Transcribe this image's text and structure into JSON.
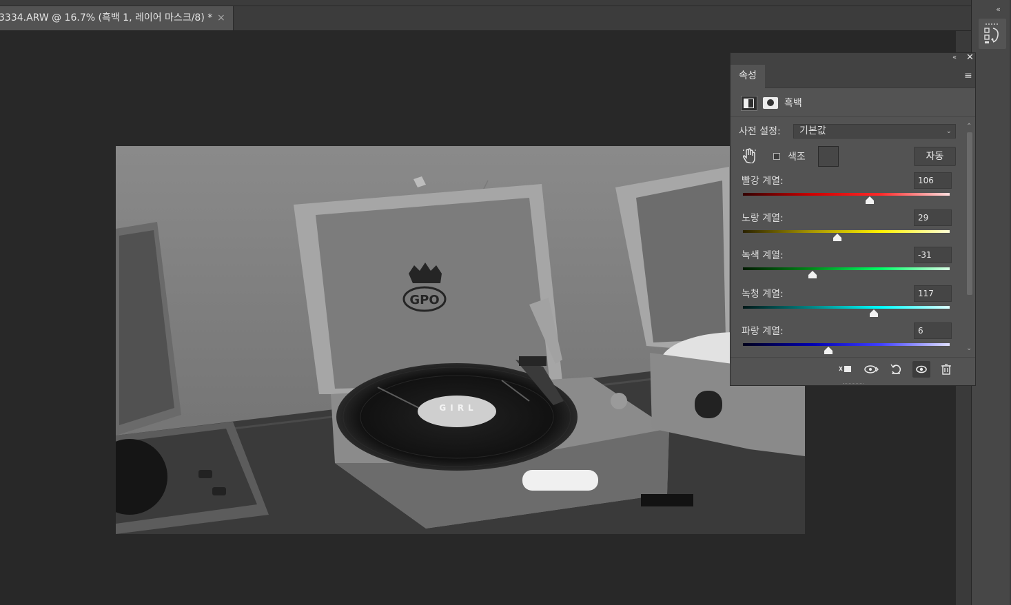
{
  "document_tab": {
    "title": "3334.ARW @ 16.7% (흑백 1, 레이어 마스크/8) *",
    "close_glyph": "×"
  },
  "right_dock": {
    "collapse_glyph": "«",
    "history_icon": "history-icon"
  },
  "properties_panel": {
    "collapse_glyph": "«",
    "close_glyph": "✕",
    "tab_label": "속성",
    "menu_glyph": "≡",
    "adjustment_icon": "bw-adjustment-icon",
    "mask_icon": "layer-mask-icon",
    "adjustment_type": "흑백",
    "preset_label": "사전 설정:",
    "preset_value": "기본값",
    "targeted_adjustment_icon": "hand-icon",
    "tint_label": "색조",
    "tint_checked": false,
    "auto_label": "자동",
    "slider_range": [
      -200,
      300
    ],
    "sliders": [
      {
        "label": "빨강 계열:",
        "value": "106",
        "gradient": [
          "#330000",
          "#cc0000",
          "#ff2a2a",
          "#ffdede"
        ]
      },
      {
        "label": "노랑 계열:",
        "value": "29",
        "gradient": [
          "#2a2200",
          "#a89600",
          "#fff200",
          "#ffffd8"
        ]
      },
      {
        "label": "녹색 계열:",
        "value": "-31",
        "gradient": [
          "#001a00",
          "#008a1a",
          "#00ff66",
          "#d8ffe4"
        ]
      },
      {
        "label": "녹청 계열:",
        "value": "117",
        "gradient": [
          "#001818",
          "#008585",
          "#00ffff",
          "#dcffff"
        ]
      },
      {
        "label": "파랑 계열:",
        "value": "6",
        "gradient": [
          "#00001a",
          "#0000b0",
          "#4040ff",
          "#e0e0ff"
        ]
      }
    ],
    "footer_icons": [
      "clip-to-layer-icon",
      "view-previous-icon",
      "reset-icon",
      "visibility-icon",
      "trash-icon"
    ]
  }
}
